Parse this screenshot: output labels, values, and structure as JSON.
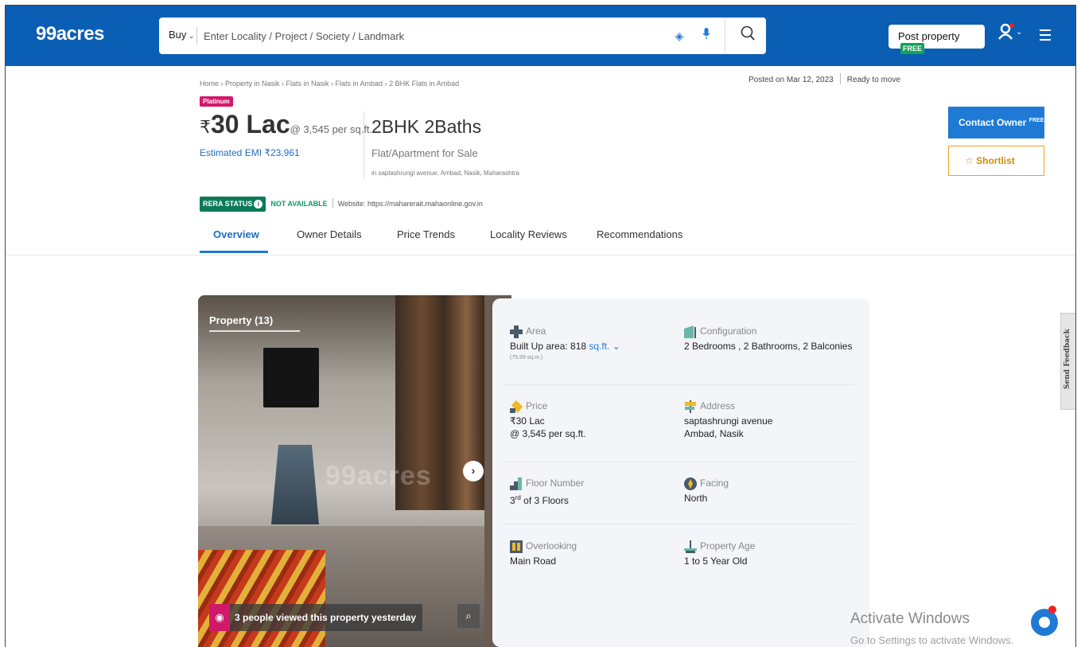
{
  "header": {
    "logo": "99acres",
    "search_type": "Buy",
    "search_placeholder": "Enter Locality / Project / Society / Landmark",
    "post_property_label": "Post property",
    "free_badge": "FREE",
    "brand_color": "#0a5fb4"
  },
  "breadcrumb": "Home › Property in Nasik › Flats in Nasik › Flats in Ambad › 2 BHK Flats in Ambad",
  "posted_on": "Posted on Mar 12, 2023",
  "ready_status": "Ready to move",
  "listing": {
    "tier_badge": "Platinum",
    "currency": "₹",
    "price": "30 Lac",
    "price_per_sqft": "@ 3,545 per sq.ft.",
    "emi": "Estimated EMI ₹23,961",
    "title": "2BHK 2Baths",
    "property_type": "Flat/Apartment for Sale",
    "address_line": "in saptashrungi avenue, Ambad, Nasik, Maharashtra"
  },
  "actions": {
    "contact_owner": "Contact Owner",
    "contact_free": "FREE",
    "shortlist": "Shortlist"
  },
  "rera": {
    "status_label": "RERA STATUS",
    "status_value": "NOT AVAILABLE",
    "website": "Website: https://maharerait.mahaonline.gov.in"
  },
  "tabs": [
    "Overview",
    "Owner Details",
    "Price Trends",
    "Locality Reviews",
    "Recommendations"
  ],
  "photo": {
    "title": "Property (13)",
    "watermark": "99acres",
    "viewed_text": "3 people viewed this property yesterday"
  },
  "details": {
    "area": {
      "label": "Area",
      "value": "Built Up area: 818",
      "unit": "sq.ft.",
      "sub": "(75.99 sq.m.)"
    },
    "configuration": {
      "label": "Configuration",
      "value": "2 Bedrooms , 2 Bathrooms, 2 Balconies"
    },
    "price": {
      "label": "Price",
      "value": "₹30 Lac",
      "value2": "@ 3,545 per sq.ft."
    },
    "address": {
      "label": "Address",
      "value": "saptashrungi avenue",
      "value2": "Ambad, Nasik"
    },
    "floor": {
      "label": "Floor Number",
      "value_num": "3",
      "value_sup": "rd",
      "value_rest": " of 3 Floors"
    },
    "facing": {
      "label": "Facing",
      "value": "North"
    },
    "overlooking": {
      "label": "Overlooking",
      "value": "Main Road"
    },
    "age": {
      "label": "Property Age",
      "value": "1 to 5 Year Old"
    }
  },
  "system": {
    "activate_title": "Activate Windows",
    "activate_sub": "Go to Settings to activate Windows.",
    "feedback": "Send Feedback"
  }
}
